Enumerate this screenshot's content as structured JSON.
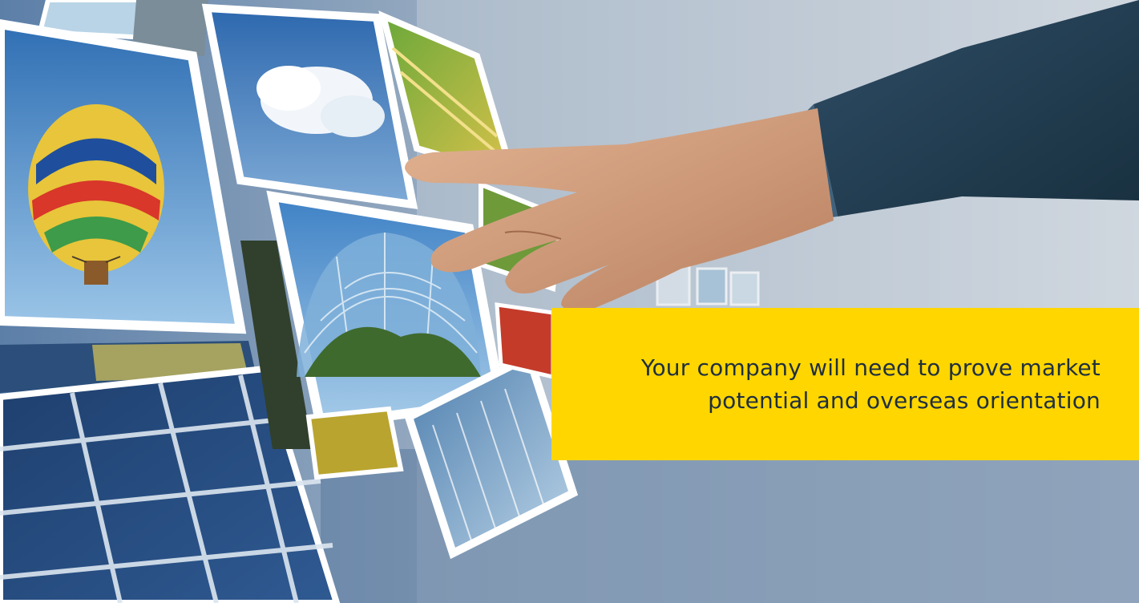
{
  "hero": {
    "caption_lines": [
      "Your company will need to prove market",
      "potential and overseas orientation"
    ],
    "image_subjects": [
      "hot-air balloon",
      "cloudy sky",
      "glass dome",
      "solar panel",
      "office building",
      "crop field",
      "pointing hand"
    ]
  },
  "colors": {
    "caption_background": "#ffd600",
    "caption_text": "#1f2f3f",
    "sky_top": "#aeb9c8",
    "sky_bottom": "#6f87a2"
  }
}
